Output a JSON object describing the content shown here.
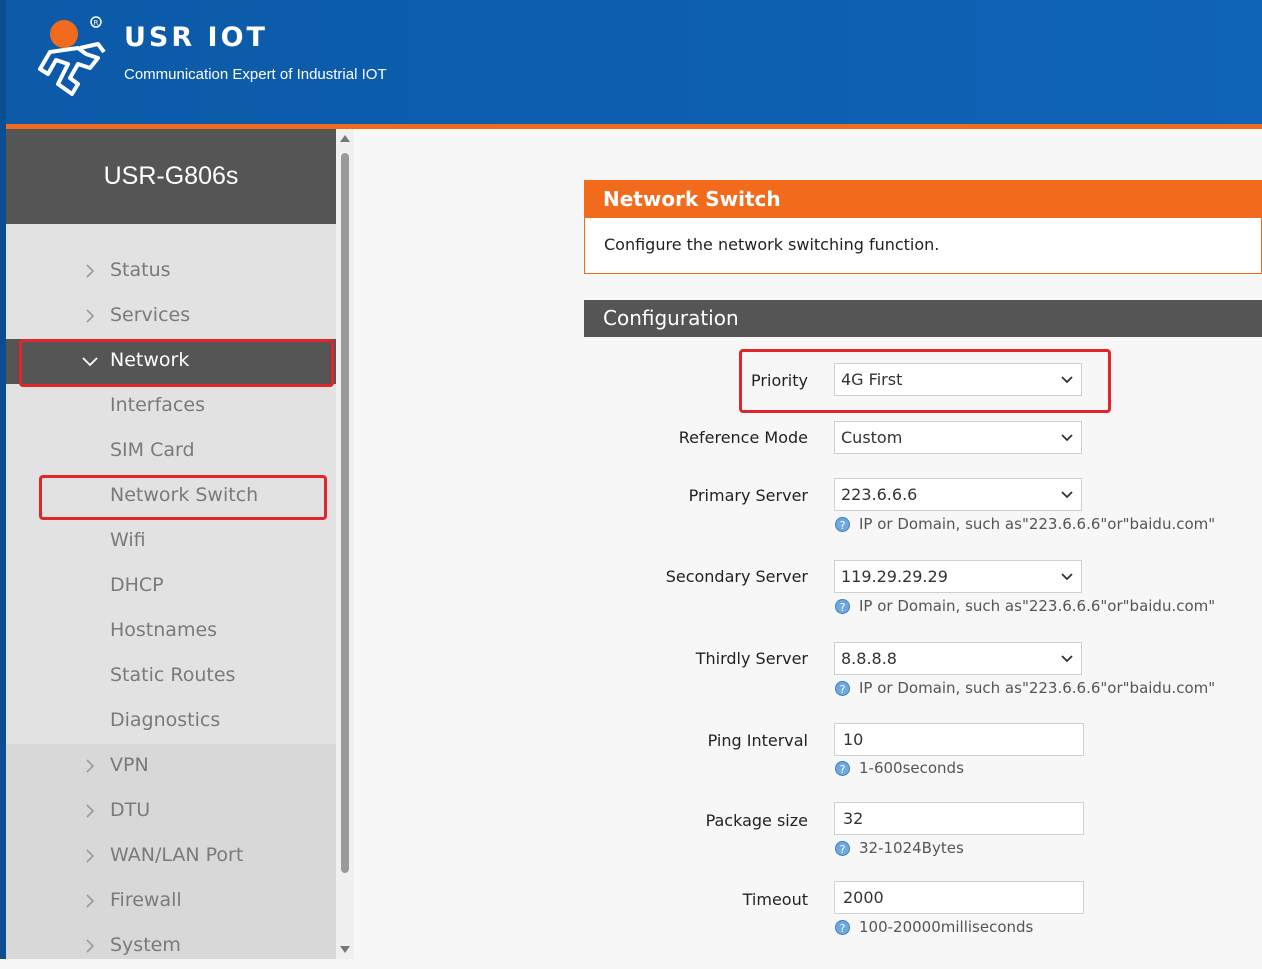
{
  "header": {
    "brand": "USR IOT",
    "tagline": "Communication Expert of Industrial IOT",
    "colors": {
      "header_blue": "#0d5fb0",
      "accent_orange": "#f26b1d"
    }
  },
  "sidebar": {
    "device": "USR-G806s",
    "items": [
      {
        "label": "Status",
        "icon": "chevron-right-icon"
      },
      {
        "label": "Services",
        "icon": "chevron-right-icon"
      },
      {
        "label": "Network",
        "icon": "chevron-down-icon",
        "active": true
      },
      {
        "label": "Interfaces"
      },
      {
        "label": "SIM Card"
      },
      {
        "label": "Network Switch",
        "selected": true
      },
      {
        "label": "Wifi"
      },
      {
        "label": "DHCP"
      },
      {
        "label": "Hostnames"
      },
      {
        "label": "Static Routes"
      },
      {
        "label": "Diagnostics"
      },
      {
        "label": "VPN",
        "icon": "chevron-right-icon"
      },
      {
        "label": "DTU",
        "icon": "chevron-right-icon"
      },
      {
        "label": "WAN/LAN Port",
        "icon": "chevron-right-icon"
      },
      {
        "label": "Firewall",
        "icon": "chevron-right-icon"
      },
      {
        "label": "System",
        "icon": "chevron-right-icon"
      }
    ]
  },
  "page": {
    "title": "Network Switch",
    "description": "Configure the network switching function.",
    "section": "Configuration"
  },
  "form": {
    "priority": {
      "label": "Priority",
      "value": "4G First"
    },
    "reference_mode": {
      "label": "Reference Mode",
      "value": "Custom"
    },
    "primary_server": {
      "label": "Primary Server",
      "value": "223.6.6.6",
      "hint": "IP or Domain, such as\"223.6.6.6\"or\"baidu.com\""
    },
    "secondary_server": {
      "label": "Secondary Server",
      "value": "119.29.29.29",
      "hint": "IP or Domain, such as\"223.6.6.6\"or\"baidu.com\""
    },
    "thirdly_server": {
      "label": "Thirdly Server",
      "value": "8.8.8.8",
      "hint": "IP or Domain, such as\"223.6.6.6\"or\"baidu.com\""
    },
    "ping_interval": {
      "label": "Ping Interval",
      "value": "10",
      "hint": "1-600seconds"
    },
    "package_size": {
      "label": "Package size",
      "value": "32",
      "hint": "32-1024Bytes"
    },
    "timeout": {
      "label": "Timeout",
      "value": "2000",
      "hint": "100-20000milliseconds"
    }
  }
}
